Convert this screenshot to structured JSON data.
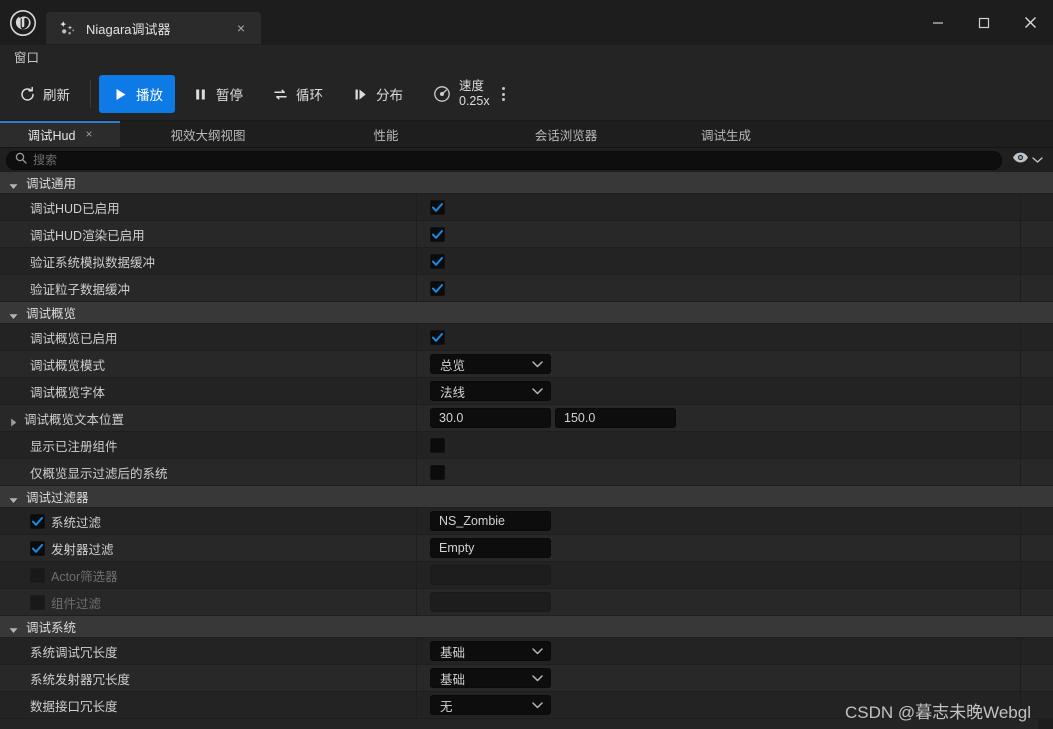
{
  "window": {
    "tab_title": "Niagara调试器",
    "tab_close": "×",
    "minimize": "─",
    "maximize": "□",
    "close": "✕"
  },
  "menubar": {
    "items": [
      {
        "label": "窗口"
      }
    ]
  },
  "toolbar": {
    "refresh": "刷新",
    "play": "播放",
    "pause": "暂停",
    "loop": "循环",
    "step": "分布",
    "speed_label": "速度",
    "speed_value": "0.25x"
  },
  "tabs": [
    {
      "label": "调试Hud",
      "active": true,
      "close": "×"
    },
    {
      "label": "视效大纲视图",
      "active": false
    },
    {
      "label": "性能",
      "active": false
    },
    {
      "label": "会话浏览器",
      "active": false
    },
    {
      "label": "调试生成",
      "active": false
    }
  ],
  "search": {
    "placeholder": "搜索",
    "value": ""
  },
  "sections": [
    {
      "title": "调试通用",
      "expanded": true,
      "rows": [
        {
          "label": "调试HUD已启用",
          "type": "checkbox",
          "checked": true
        },
        {
          "label": "调试HUD渲染已启用",
          "type": "checkbox",
          "checked": true
        },
        {
          "label": "验证系统模拟数据缓冲",
          "type": "checkbox",
          "checked": true
        },
        {
          "label": "验证粒子数据缓冲",
          "type": "checkbox",
          "checked": true
        }
      ]
    },
    {
      "title": "调试概览",
      "expanded": true,
      "rows": [
        {
          "label": "调试概览已启用",
          "type": "checkbox",
          "checked": true
        },
        {
          "label": "调试概览模式",
          "type": "dropdown",
          "value": "总览"
        },
        {
          "label": "调试概览字体",
          "type": "dropdown",
          "value": "法线"
        },
        {
          "label": "调试概览文本位置",
          "type": "vector2",
          "expander": "collapsed",
          "value_x": "30.0",
          "value_y": "150.0"
        },
        {
          "label": "显示已注册组件",
          "type": "checkbox",
          "checked": false
        },
        {
          "label": "仅概览显示过滤后的系统",
          "type": "checkbox",
          "checked": false
        }
      ]
    },
    {
      "title": "调试过滤器",
      "expanded": true,
      "rows": [
        {
          "label": "系统过滤",
          "type": "text",
          "inline_checkbox": true,
          "checked": true,
          "disabled": false,
          "value": "NS_Zombie"
        },
        {
          "label": "发射器过滤",
          "type": "text",
          "inline_checkbox": true,
          "checked": true,
          "disabled": false,
          "value": "Empty"
        },
        {
          "label": "Actor筛选器",
          "type": "text",
          "inline_checkbox": true,
          "checked": false,
          "disabled": true,
          "value": ""
        },
        {
          "label": "组件过滤",
          "type": "text",
          "inline_checkbox": true,
          "checked": false,
          "disabled": true,
          "value": ""
        }
      ]
    },
    {
      "title": "调试系统",
      "expanded": true,
      "rows": [
        {
          "label": "系统调试冗长度",
          "type": "dropdown",
          "value": "基础"
        },
        {
          "label": "系统发射器冗长度",
          "type": "dropdown",
          "value": "基础"
        },
        {
          "label": "数据接口冗长度",
          "type": "dropdown",
          "value": "无"
        }
      ]
    }
  ],
  "watermark": "CSDN @暮志未晚Webgl",
  "colors": {
    "accent": "#0d7ae5",
    "tab_underline": "#2a7fd4",
    "section_header": "#383838"
  }
}
